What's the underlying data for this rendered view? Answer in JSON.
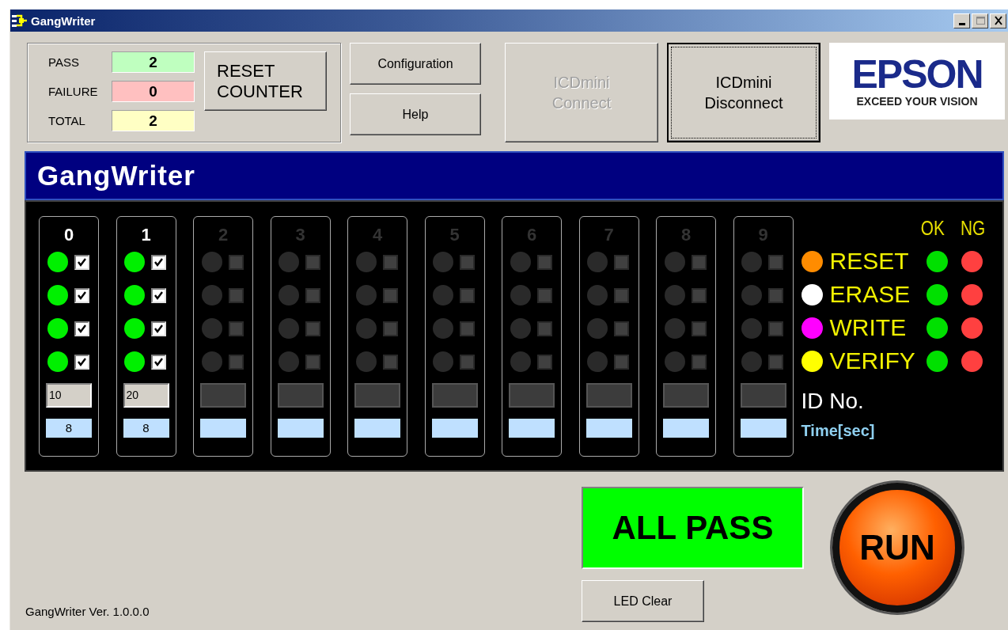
{
  "window": {
    "title": "GangWriter"
  },
  "counters": [
    {
      "label": "PASS",
      "value": "2",
      "color": "#bfffbf"
    },
    {
      "label": "FAILURE",
      "value": "0",
      "color": "#ffc0c0"
    },
    {
      "label": "TOTAL",
      "value": "2",
      "color": "#ffffc4"
    }
  ],
  "reset_button": "RESET COUNTER",
  "menu_buttons": [
    "Configuration",
    "Help"
  ],
  "connect_buttons": [
    {
      "label": "ICDmini Connect",
      "disabled": true
    },
    {
      "label": "ICDmini Disconnect",
      "disabled": false
    }
  ],
  "logo": {
    "brand": "EPSON",
    "tagline": "EXCEED YOUR VISION"
  },
  "banner": "GangWriter",
  "channels": [
    {
      "number": "0",
      "enabled": true,
      "slots": [
        {
          "lit": true,
          "checked": true
        },
        {
          "lit": true,
          "checked": true
        },
        {
          "lit": true,
          "checked": true
        },
        {
          "lit": true,
          "checked": true
        }
      ],
      "id": "10",
      "time": "8"
    },
    {
      "number": "1",
      "enabled": true,
      "slots": [
        {
          "lit": true,
          "checked": true
        },
        {
          "lit": true,
          "checked": true
        },
        {
          "lit": true,
          "checked": true
        },
        {
          "lit": true,
          "checked": true
        }
      ],
      "id": "20",
      "time": "8"
    },
    {
      "number": "2",
      "enabled": false,
      "slots": [
        {
          "lit": false,
          "checked": false
        },
        {
          "lit": false,
          "checked": false
        },
        {
          "lit": false,
          "checked": false
        },
        {
          "lit": false,
          "checked": false
        }
      ]
    },
    {
      "number": "3",
      "enabled": false,
      "slots": [
        {
          "lit": false,
          "checked": false
        },
        {
          "lit": false,
          "checked": false
        },
        {
          "lit": false,
          "checked": false
        },
        {
          "lit": false,
          "checked": false
        }
      ]
    },
    {
      "number": "4",
      "enabled": false,
      "slots": [
        {
          "lit": false,
          "checked": false
        },
        {
          "lit": false,
          "checked": false
        },
        {
          "lit": false,
          "checked": false
        },
        {
          "lit": false,
          "checked": false
        }
      ]
    },
    {
      "number": "5",
      "enabled": false,
      "slots": [
        {
          "lit": false,
          "checked": false
        },
        {
          "lit": false,
          "checked": false
        },
        {
          "lit": false,
          "checked": false
        },
        {
          "lit": false,
          "checked": false
        }
      ]
    },
    {
      "number": "6",
      "enabled": false,
      "slots": [
        {
          "lit": false,
          "checked": false
        },
        {
          "lit": false,
          "checked": false
        },
        {
          "lit": false,
          "checked": false
        },
        {
          "lit": false,
          "checked": false
        }
      ]
    },
    {
      "number": "7",
      "enabled": false,
      "slots": [
        {
          "lit": false,
          "checked": false
        },
        {
          "lit": false,
          "checked": false
        },
        {
          "lit": false,
          "checked": false
        },
        {
          "lit": false,
          "checked": false
        }
      ]
    },
    {
      "number": "8",
      "enabled": false,
      "slots": [
        {
          "lit": false,
          "checked": false
        },
        {
          "lit": false,
          "checked": false
        },
        {
          "lit": false,
          "checked": false
        },
        {
          "lit": false,
          "checked": false
        }
      ]
    },
    {
      "number": "9",
      "enabled": false,
      "slots": [
        {
          "lit": false,
          "checked": false
        },
        {
          "lit": false,
          "checked": false
        },
        {
          "lit": false,
          "checked": false
        },
        {
          "lit": false,
          "checked": false
        }
      ]
    }
  ],
  "legend": {
    "headers": [
      "OK",
      "NG"
    ],
    "steps": [
      {
        "label": "RESET",
        "color": "#ff8c00"
      },
      {
        "label": "ERASE",
        "color": "#ffffff"
      },
      {
        "label": "WRITE",
        "color": "#ff00ff"
      },
      {
        "label": "VERIFY",
        "color": "#ffff00"
      }
    ],
    "id_label": "ID No.",
    "time_label": "Time[sec]"
  },
  "result": "ALL PASS",
  "led_clear_button": "LED Clear",
  "run_button": "RUN",
  "version": "GangWriter Ver. 1.0.0.0"
}
